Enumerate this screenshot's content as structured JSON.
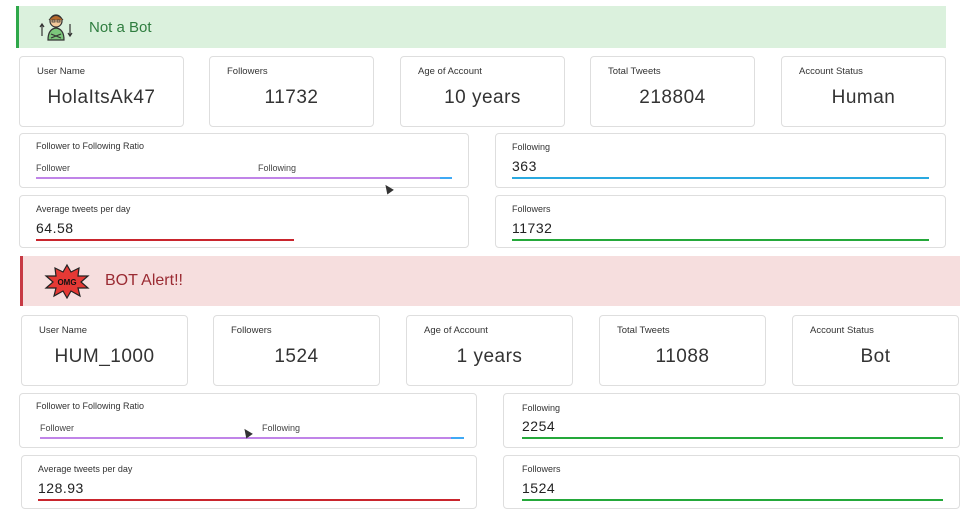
{
  "account1": {
    "alert_label": "Not a Bot",
    "alert_icon": "human-mascot-icon",
    "stats": [
      {
        "caption": "User Name",
        "value": "HolaItsAk47"
      },
      {
        "caption": "Followers",
        "value": "11732"
      },
      {
        "caption": "Age of Account",
        "value": "10 years"
      },
      {
        "caption": "Total Tweets",
        "value": "218804"
      },
      {
        "caption": "Account Status",
        "value": "Human"
      }
    ],
    "ratio": {
      "caption": "Follower to Following Ratio",
      "follower_label": "Follower",
      "following_label": "Following",
      "follower_fraction": 0.97
    },
    "following": {
      "caption": "Following",
      "value": "363",
      "color": "#29a9e0"
    },
    "avg_tweets": {
      "caption": "Average tweets per day",
      "value": "64.58",
      "color": "#c9252d",
      "fraction": 0.62
    },
    "followers": {
      "caption": "Followers",
      "value": "11732",
      "color": "#24a83a"
    }
  },
  "account2": {
    "alert_label": "BOT Alert!!",
    "alert_icon": "omg-burst-icon",
    "alert_icon_text": "OMG",
    "stats": [
      {
        "caption": "User Name",
        "value": "HUM_1000"
      },
      {
        "caption": "Followers",
        "value": "1524"
      },
      {
        "caption": "Age of Account",
        "value": "1 years"
      },
      {
        "caption": "Total Tweets",
        "value": "11088"
      },
      {
        "caption": "Account Status",
        "value": "Bot"
      }
    ],
    "ratio": {
      "caption": "Follower to Following Ratio",
      "follower_label": "Follower",
      "following_label": "Following",
      "follower_fraction": 0.97
    },
    "following": {
      "caption": "Following",
      "value": "2254",
      "color": "#24a83a"
    },
    "avg_tweets": {
      "caption": "Average tweets per day",
      "value": "128.93",
      "color": "#c9252d",
      "fraction": 1.0
    },
    "followers": {
      "caption": "Followers",
      "value": "1524",
      "color": "#24a83a"
    }
  },
  "colors": {
    "ratio_follower": "#c084e8",
    "ratio_following": "#3fa9f5",
    "success": "#2ea84a",
    "danger": "#c73a44"
  }
}
